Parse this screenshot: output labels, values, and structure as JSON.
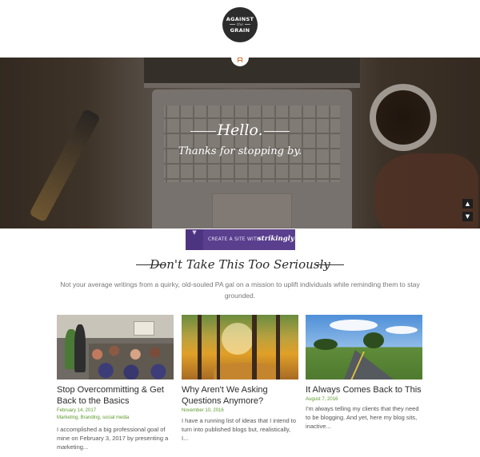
{
  "logo": {
    "line1": "AGAINST",
    "line2": "the",
    "line3": "GRAIN"
  },
  "hero": {
    "heading": "Hello.",
    "tagline": "Thanks for stopping by.",
    "scroll_up": "▲",
    "scroll_down": "▼"
  },
  "strikingly_banner": {
    "chevron": "▼",
    "label": "CREATE A SITE WITH",
    "brand": "strikingly",
    "brand_color": "#5a3f8e"
  },
  "section": {
    "title": "Don't Take This Too Seriously",
    "intro": "Not your average writings from a quirky, old-souled PA gal on a mission to uplift individuals while reminding them to stay grounded."
  },
  "posts": [
    {
      "title": "Stop Overcommitting & Get Back to the Basics",
      "date": "February 14, 2017",
      "tags": "Marketing, Branding, social media",
      "excerpt": "I accomplished a big professional goal of mine on February 3, 2017 by presenting a marketing..."
    },
    {
      "title": "Why Aren't We Asking Questions Anymore?",
      "date": "November 10, 2016",
      "tags": "",
      "excerpt": "I have a running list of ideas that I intend to turn into published blogs but, realistically, I..."
    },
    {
      "title": "It Always Comes Back to This",
      "date": "August 7, 2016",
      "tags": "",
      "excerpt": "I'm always telling my clients that they need to be blogging. And yet, here my blog sits, inactive..."
    }
  ],
  "colors": {
    "accent_green": "#5c9a2b",
    "logo_bg": "#2c2c2c"
  }
}
